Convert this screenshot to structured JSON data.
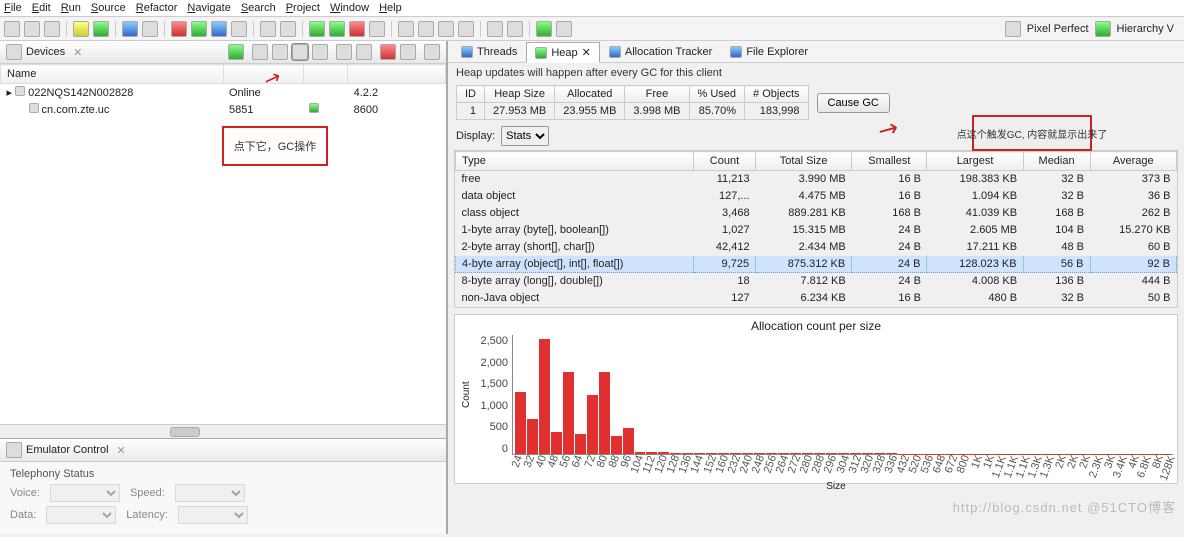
{
  "menu": [
    "File",
    "Edit",
    "Run",
    "Source",
    "Refactor",
    "Navigate",
    "Search",
    "Project",
    "Window",
    "Help"
  ],
  "right_tools": {
    "pixel": "Pixel Perfect",
    "hier": "Hierarchy V"
  },
  "devices": {
    "title": "Devices",
    "columns": [
      "Name",
      "",
      "",
      ""
    ],
    "rows": [
      {
        "name": "022NQS142N002828",
        "c2": "Online",
        "c3": "",
        "c4": "4.2.2"
      },
      {
        "name": "cn.com.zte.uc",
        "c2": "5851",
        "c3": "",
        "c4": "8600",
        "child": true,
        "bug": true
      }
    ]
  },
  "annotations": {
    "gc_hint": "点下它，GC操作",
    "cause_hint": "点这个触发GC, 内容就显示出来了"
  },
  "emulator": {
    "title": "Emulator Control",
    "section": "Telephony Status",
    "voice": "Voice:",
    "speed": "Speed:",
    "data": "Data:",
    "latency": "Latency:"
  },
  "tabs": [
    {
      "label": "Threads",
      "icon": "threads-icon"
    },
    {
      "label": "Heap",
      "icon": "heap-icon",
      "active": true
    },
    {
      "label": "Allocation Tracker",
      "icon": "alloc-icon"
    },
    {
      "label": "File Explorer",
      "icon": "file-icon"
    }
  ],
  "heap": {
    "info": "Heap updates will happen after every GC for this client",
    "summary_columns": [
      "ID",
      "Heap Size",
      "Allocated",
      "Free",
      "% Used",
      "# Objects"
    ],
    "summary_row": {
      "id": "1",
      "heap": "27.953 MB",
      "alloc": "23.955 MB",
      "free": "3.998 MB",
      "used": "85.70%",
      "obj": "183,998"
    },
    "cause_btn": "Cause GC",
    "display_label": "Display:",
    "display_value": "Stats",
    "type_columns": [
      "Type",
      "Count",
      "Total Size",
      "Smallest",
      "Largest",
      "Median",
      "Average"
    ],
    "types": [
      {
        "t": "free",
        "c": "11,213",
        "ts": "3.990 MB",
        "s": "16 B",
        "l": "198.383 KB",
        "m": "32 B",
        "a": "373 B"
      },
      {
        "t": "data object",
        "c": "127,...",
        "ts": "4.475 MB",
        "s": "16 B",
        "l": "1.094 KB",
        "m": "32 B",
        "a": "36 B"
      },
      {
        "t": "class object",
        "c": "3,468",
        "ts": "889.281 KB",
        "s": "168 B",
        "l": "41.039 KB",
        "m": "168 B",
        "a": "262 B"
      },
      {
        "t": "1-byte array (byte[], boolean[])",
        "c": "1,027",
        "ts": "15.315 MB",
        "s": "24 B",
        "l": "2.605 MB",
        "m": "104 B",
        "a": "15.270 KB"
      },
      {
        "t": "2-byte array (short[], char[])",
        "c": "42,412",
        "ts": "2.434 MB",
        "s": "24 B",
        "l": "17.211 KB",
        "m": "48 B",
        "a": "60 B"
      },
      {
        "t": "4-byte array (object[], int[], float[])",
        "c": "9,725",
        "ts": "875.312 KB",
        "s": "24 B",
        "l": "128.023 KB",
        "m": "56 B",
        "a": "92 B",
        "sel": true
      },
      {
        "t": "8-byte array (long[], double[])",
        "c": "18",
        "ts": "7.812 KB",
        "s": "24 B",
        "l": "4.008 KB",
        "m": "136 B",
        "a": "444 B"
      },
      {
        "t": "non-Java object",
        "c": "127",
        "ts": "6.234 KB",
        "s": "16 B",
        "l": "480 B",
        "m": "32 B",
        "a": "50 B"
      }
    ]
  },
  "chart_data": {
    "type": "bar",
    "title": "Allocation count per size",
    "xlabel": "Size",
    "ylabel": "Count",
    "ylim": [
      0,
      2700
    ],
    "yticks": [
      0,
      500,
      1000,
      1500,
      2000,
      2500
    ],
    "categories": [
      "24",
      "32",
      "40",
      "48",
      "56",
      "64",
      "72",
      "80",
      "88",
      "96",
      "104",
      "112",
      "120",
      "128",
      "136",
      "144",
      "152",
      "160",
      "232",
      "240",
      "248",
      "256",
      "264",
      "272",
      "280",
      "288",
      "296",
      "304",
      "312",
      "320",
      "328",
      "336",
      "432",
      "520",
      "536",
      "648",
      "672",
      "800",
      "1K",
      "1K",
      "1.1K",
      "1.1K",
      "1.1K",
      "1.3K",
      "1.3K",
      "2K",
      "2K",
      "2K",
      "2.3K",
      "3K",
      "3.4K",
      "4K",
      "6.8K",
      "8K",
      "128K"
    ],
    "values": [
      1400,
      800,
      2600,
      500,
      1850,
      450,
      1350,
      1850,
      400,
      600,
      50,
      50,
      50,
      30,
      30,
      20,
      20,
      20,
      15,
      15,
      15,
      15,
      15,
      15,
      15,
      15,
      15,
      15,
      15,
      15,
      15,
      15,
      10,
      10,
      10,
      10,
      10,
      10,
      10,
      10,
      10,
      10,
      10,
      10,
      10,
      10,
      10,
      10,
      10,
      10,
      10,
      10,
      10,
      10,
      10
    ]
  },
  "watermark": "http://blog.csdn.net @51CTO博客"
}
